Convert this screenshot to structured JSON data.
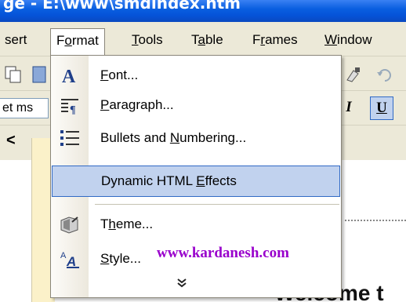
{
  "window": {
    "title": "ge - E:\\www\\smdindex.htm"
  },
  "menubar": {
    "items": [
      {
        "label": "sert",
        "open": false
      },
      {
        "label": "Format",
        "open": true
      },
      {
        "label": "Tools",
        "open": false
      },
      {
        "label": "Table",
        "open": false
      },
      {
        "label": "Frames",
        "open": false
      },
      {
        "label": "Window",
        "open": false
      }
    ]
  },
  "toolbar": {
    "font_value": "et ms",
    "italic_label": "I",
    "underline_label": "U"
  },
  "tabs": {
    "left_arrow": "<"
  },
  "format_menu": {
    "items": [
      {
        "label": "Font...",
        "icon": "font-A-icon"
      },
      {
        "label": "Paragraph...",
        "icon": "paragraph-icon"
      },
      {
        "label": "Bullets and Numbering...",
        "icon": "bullets-icon"
      },
      {
        "label": "Dynamic HTML Effects",
        "icon": "none",
        "highlighted": true
      },
      {
        "label": "Theme...",
        "icon": "theme-icon"
      },
      {
        "label": "Style...",
        "icon": "style-icon"
      }
    ],
    "expand_label": "»"
  },
  "watermark": "www.kardanesh.com",
  "document": {
    "welcome_text": "Welcome t"
  },
  "colors": {
    "title_bar": "#0a5fe0",
    "menu_highlight": "#c1d2ee",
    "menu_highlight_border": "#316ac5",
    "watermark": "#9900cc"
  }
}
